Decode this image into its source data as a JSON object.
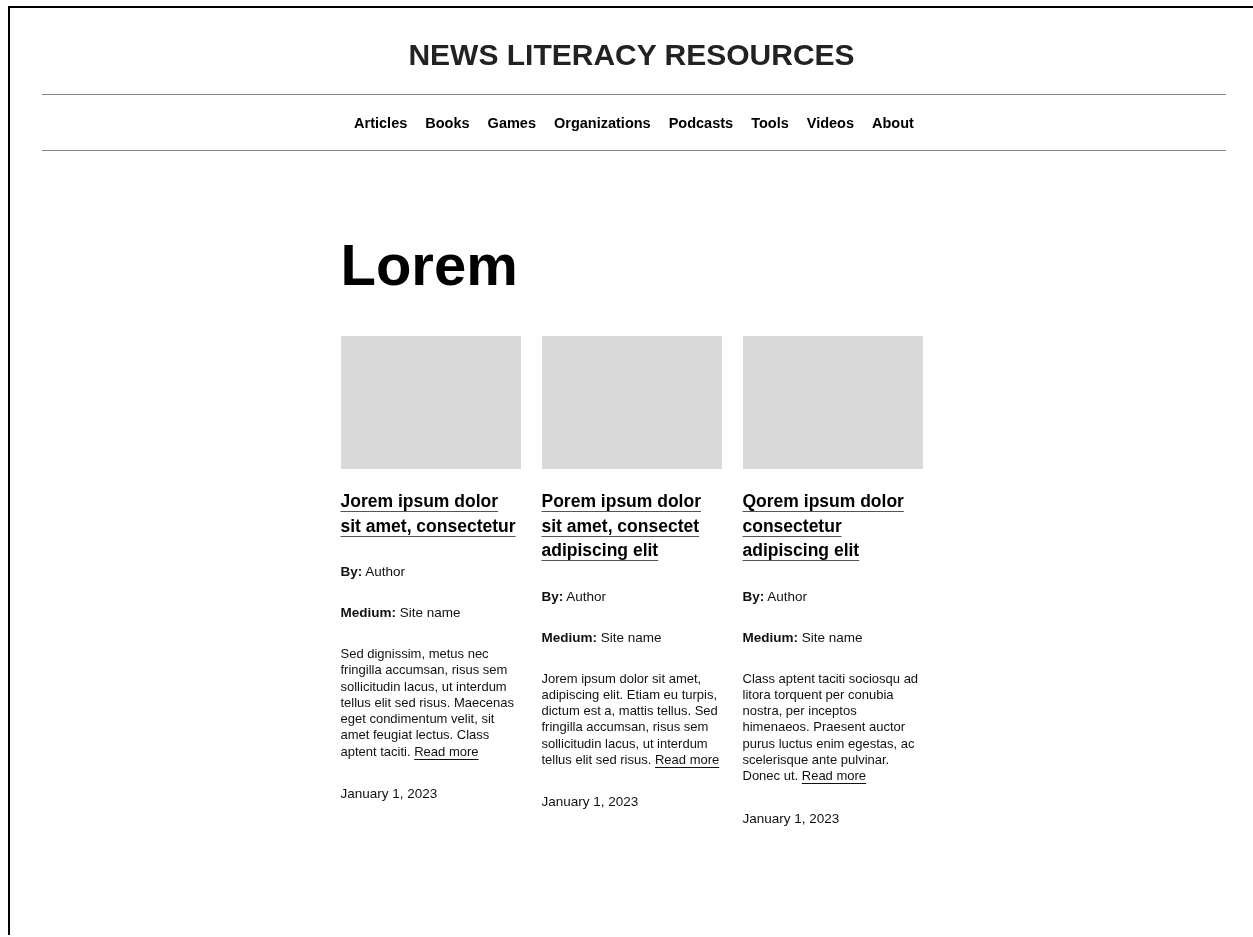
{
  "site_title": "NEWS LITERACY RESOURCES",
  "nav": [
    {
      "label": "Articles"
    },
    {
      "label": "Books"
    },
    {
      "label": "Games"
    },
    {
      "label": "Organizations"
    },
    {
      "label": "Podcasts"
    },
    {
      "label": "Tools"
    },
    {
      "label": "Videos"
    },
    {
      "label": "About"
    }
  ],
  "heading": "Lorem",
  "cards": [
    {
      "title": "Jorem ipsum dolor sit amet, consectetur",
      "byline": "**By:** Author",
      "medium": "**Medium:** Site name",
      "description": "Sed dignissim, metus nec fringilla accumsan, risus sem sollicitudin lacus, ut interdum tellus elit sed risus. Maecenas eget condimentum velit, sit amet feugiat lectus. Class aptent taciti.",
      "link": "Read more",
      "date": "January 1, 2023"
    },
    {
      "title": "Porem ipsum dolor sit amet, consectet adipiscing elit",
      "byline": "**By:** Author",
      "medium": "**Medium:** Site name",
      "description": "Jorem ipsum dolor sit amet,  adipiscing elit. Etiam eu turpis, dictum est a, mattis tellus. Sed fringilla accumsan, risus sem sollicitudin lacus, ut interdum tellus elit sed risus.",
      "link": "Read more",
      "date": "January 1, 2023"
    },
    {
      "title": "Qorem ipsum dolor consectetur adipiscing elit",
      "byline": "**By:** Author",
      "medium": "**Medium:** Site name",
      "description": "Class aptent taciti sociosqu ad litora torquent per conubia nostra, per inceptos himenaeos. Praesent auctor purus luctus enim egestas, ac scelerisque ante pulvinar. Donec ut.",
      "link": "Read more",
      "date": "January 1, 2023"
    }
  ]
}
